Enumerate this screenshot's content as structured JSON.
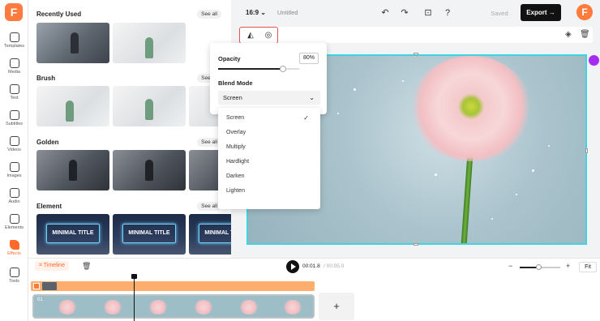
{
  "rail": {
    "logo": "F",
    "items": [
      {
        "label": "Templates"
      },
      {
        "label": "Media"
      },
      {
        "label": "Text"
      },
      {
        "label": "Subtitles"
      },
      {
        "label": "Videos"
      },
      {
        "label": "Images"
      },
      {
        "label": "Audio"
      },
      {
        "label": "Elements"
      },
      {
        "label": "Effects"
      },
      {
        "label": "Tools"
      }
    ]
  },
  "library": {
    "sections": [
      {
        "title": "Recently Used",
        "see_all": "See all"
      },
      {
        "title": "Brush",
        "see_all": "See all"
      },
      {
        "title": "Golden",
        "see_all": "See all"
      },
      {
        "title": "Element",
        "see_all": "See all"
      }
    ],
    "element_thumb_text": "MINIMAL TITLE"
  },
  "topbar": {
    "ratio": "16:9",
    "title": "Untitled",
    "saved": "Saved",
    "export": "Export",
    "avatar": "F"
  },
  "popup": {
    "opacity_label": "Opacity",
    "opacity_value": "80%",
    "opacity_fraction": 0.8,
    "blend_label": "Blend Mode",
    "blend_selected": "Screen"
  },
  "dropdown": {
    "options": [
      "Screen",
      "Overlay",
      "Multiply",
      "Hardlight",
      "Darken",
      "Lighten"
    ],
    "checked": "Screen"
  },
  "timeline": {
    "label": "Timeline",
    "time_current": "00:01.8",
    "time_total": "/ 00:05.0",
    "fit": "Fit",
    "clip_label": "01",
    "add": "+",
    "zoom_fraction": 0.45
  },
  "colors": {
    "accent": "#ff6a2a",
    "selection": "#3fd4e0",
    "highlight": "#e55252"
  }
}
